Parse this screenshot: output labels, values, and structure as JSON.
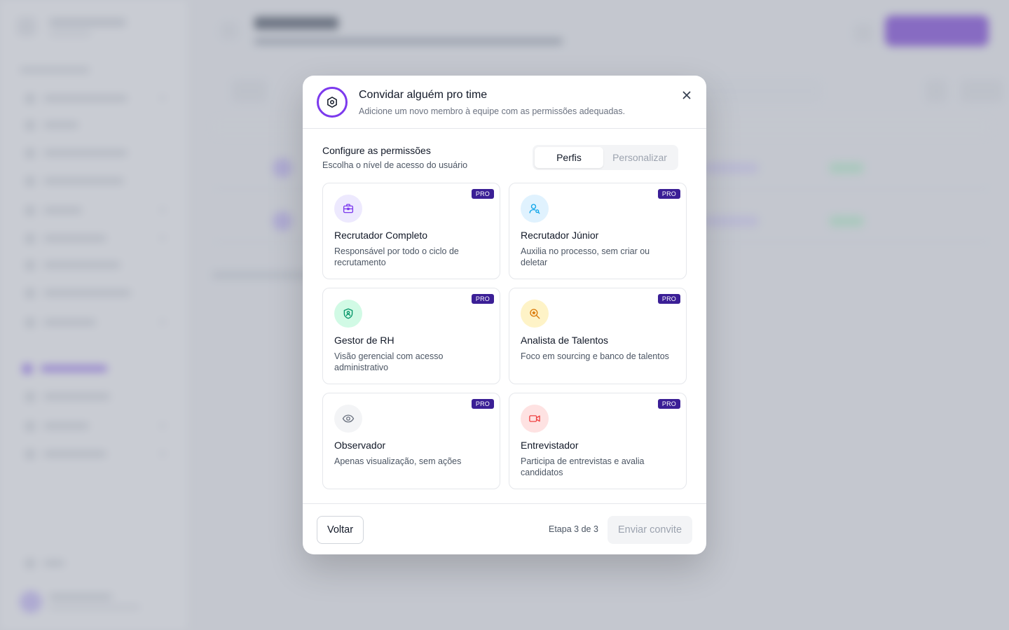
{
  "modal": {
    "title": "Convidar alguém pro time",
    "subtitle": "Adicione um novo membro à equipe com as permissões adequadas.",
    "header_icon": "hexagon-settings-icon",
    "close_icon": "close-icon"
  },
  "permissions": {
    "title": "Configure as permissões",
    "description": "Escolha o nível de acesso do usuário",
    "tabs": [
      {
        "label": "Perfis",
        "active": true
      },
      {
        "label": "Personalizar",
        "active": false
      }
    ],
    "roles": [
      {
        "title": "Recrutador Completo",
        "description": "Responsável por todo o ciclo de recrutamento",
        "badge": "PRO",
        "icon": "briefcase-icon",
        "icon_color": "#7c3aed",
        "icon_bg": "#ede9fe"
      },
      {
        "title": "Recrutador Júnior",
        "description": "Auxilia no processo, sem criar ou deletar",
        "badge": "PRO",
        "icon": "user-search-icon",
        "icon_color": "#0ea5e9",
        "icon_bg": "#e0f2fe"
      },
      {
        "title": "Gestor de RH",
        "description": "Visão gerencial com acesso administrativo",
        "badge": "PRO",
        "icon": "shield-user-icon",
        "icon_color": "#059669",
        "icon_bg": "#d1fae5"
      },
      {
        "title": "Analista de Talentos",
        "description": "Foco em sourcing e banco de talentos",
        "badge": "PRO",
        "icon": "search-star-icon",
        "icon_color": "#d97706",
        "icon_bg": "#fef3c7"
      },
      {
        "title": "Observador",
        "description": "Apenas visualização, sem ações",
        "badge": "PRO",
        "icon": "eye-icon",
        "icon_color": "#6b7280",
        "icon_bg": "#f3f4f6"
      },
      {
        "title": "Entrevistador",
        "description": "Participa de entrevistas e avalia candidatos",
        "badge": "PRO",
        "icon": "video-camera-icon",
        "icon_color": "#ef4444",
        "icon_bg": "#fee2e2"
      }
    ]
  },
  "footer": {
    "back_label": "Voltar",
    "step_text": "Etapa 3 de 3",
    "send_label": "Enviar convite"
  },
  "colors": {
    "accent": "#7c3aed",
    "badge": "#3b1f96"
  }
}
